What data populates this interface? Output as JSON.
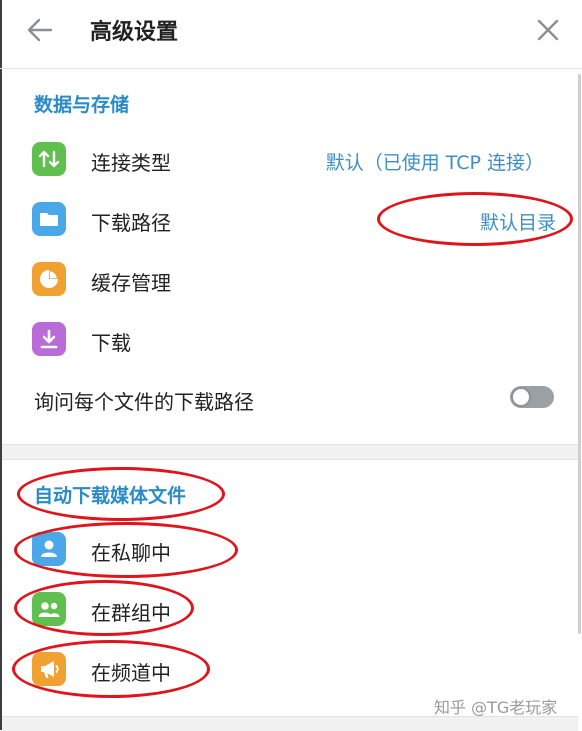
{
  "header": {
    "title": "高级设置",
    "back_icon": "arrow-left-icon",
    "close_icon": "close-icon"
  },
  "data_storage": {
    "title": "数据与存储",
    "rows": [
      {
        "label": "连接类型",
        "value": "默认（已使用 TCP 连接）",
        "icon": "swap-vertical-icon",
        "color": "#5fc04f"
      },
      {
        "label": "下载路径",
        "value": "默认目录",
        "icon": "folder-icon",
        "color": "#4aa8e8"
      },
      {
        "label": "缓存管理",
        "icon": "pie-chart-icon",
        "color": "#f0a132"
      },
      {
        "label": "下载",
        "icon": "download-icon",
        "color": "#b96cd7"
      }
    ],
    "ask_path": {
      "label": "询问每个文件的下载路径",
      "enabled": false
    }
  },
  "auto_download": {
    "title": "自动下载媒体文件",
    "rows": [
      {
        "label": "在私聊中",
        "icon": "person-icon",
        "color": "#4aa8e8"
      },
      {
        "label": "在群组中",
        "icon": "group-icon",
        "color": "#5fc04f"
      },
      {
        "label": "在频道中",
        "icon": "megaphone-icon",
        "color": "#f0a132"
      }
    ]
  },
  "annotation_color": "#e0141b",
  "watermark": "知乎 @TG老玩家"
}
